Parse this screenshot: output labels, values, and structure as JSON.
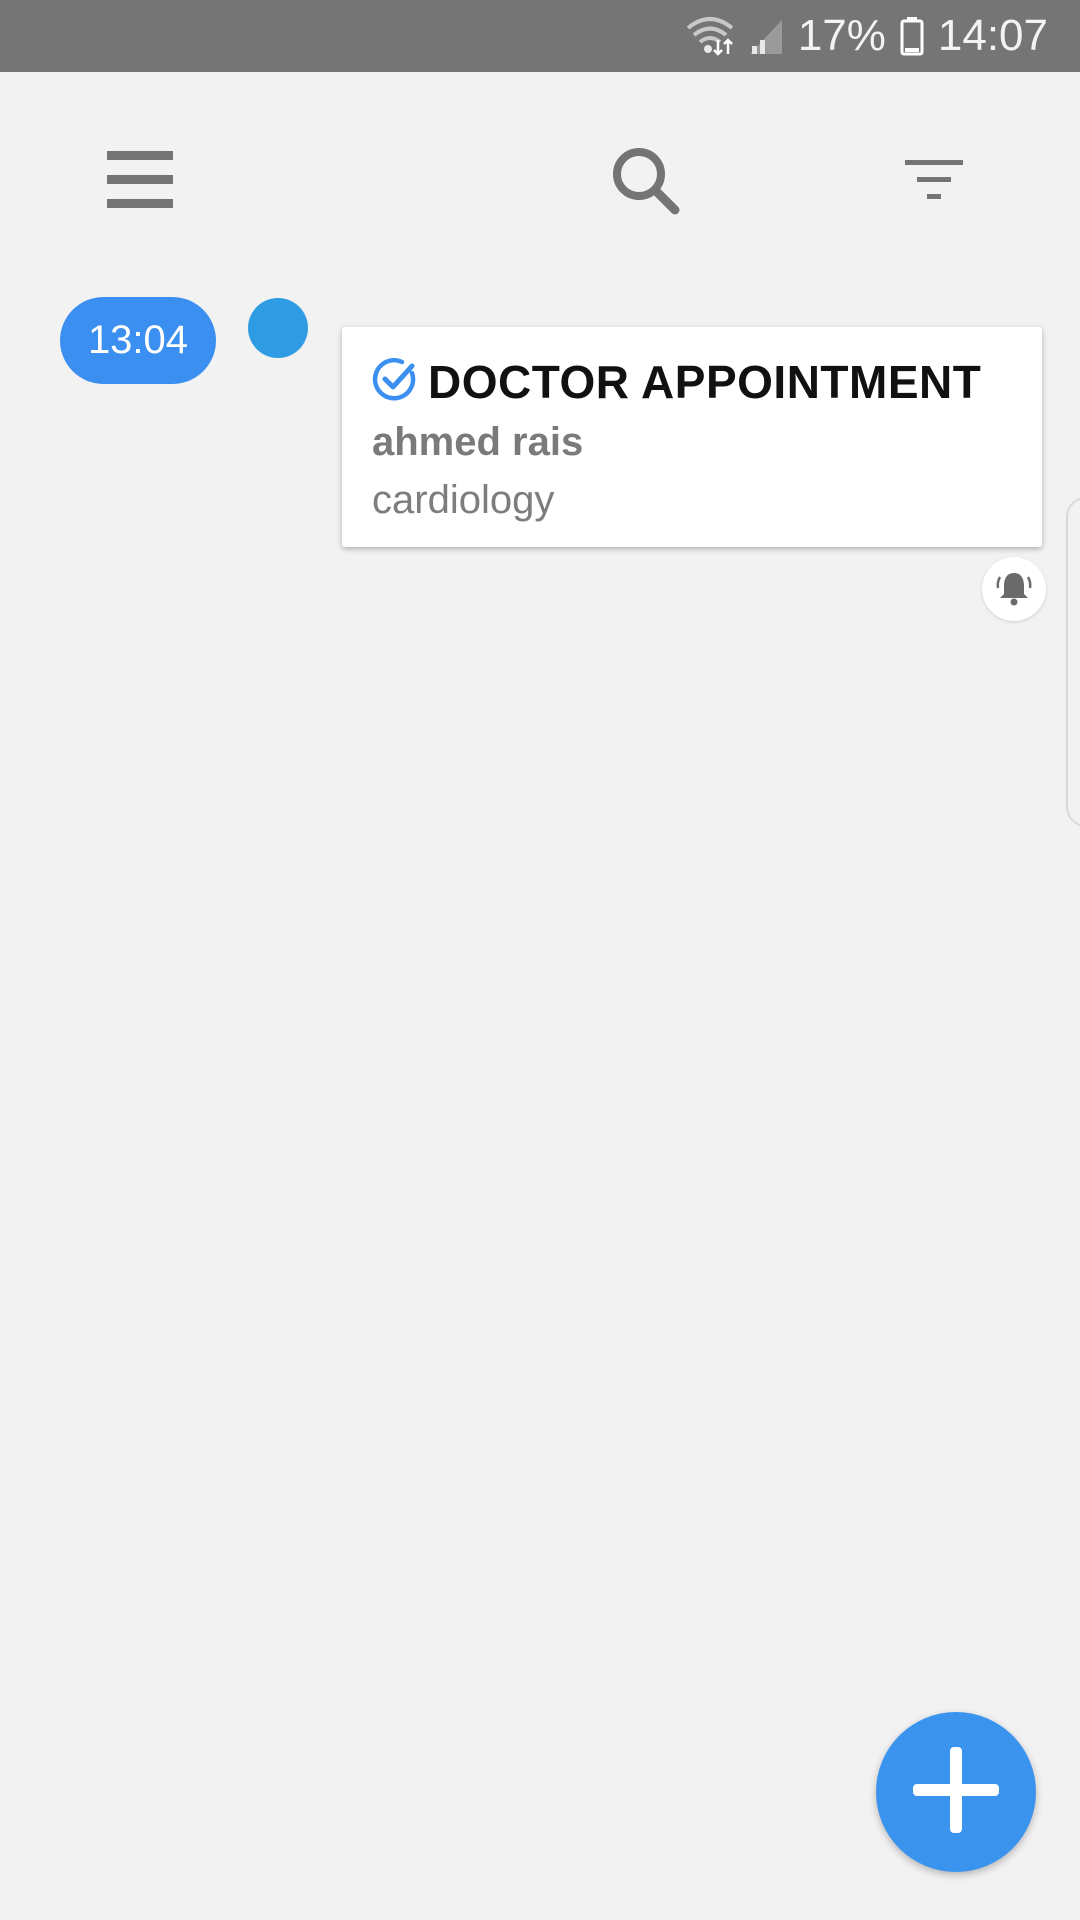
{
  "status_bar": {
    "battery_percent": "17%",
    "time": "14:07",
    "icons": [
      "wifi-icon",
      "signal-icon",
      "battery-icon"
    ]
  },
  "toolbar": {
    "menu_icon": "menu-icon",
    "search_icon": "search-icon",
    "filter_icon": "filter-icon"
  },
  "timeline": {
    "time_label": "13:04",
    "dot_color": "#2f9be3"
  },
  "event": {
    "title": "DOCTOR APPOINTMENT",
    "person": "ahmed rais",
    "department": "cardiology",
    "status_icon": "check-circle-icon",
    "alarm_icon": "alarm-bell-icon"
  },
  "fab": {
    "icon": "plus-icon"
  },
  "colors": {
    "accent": "#3a8ff0",
    "status_bar": "#757575",
    "background": "#f2f2f2"
  }
}
